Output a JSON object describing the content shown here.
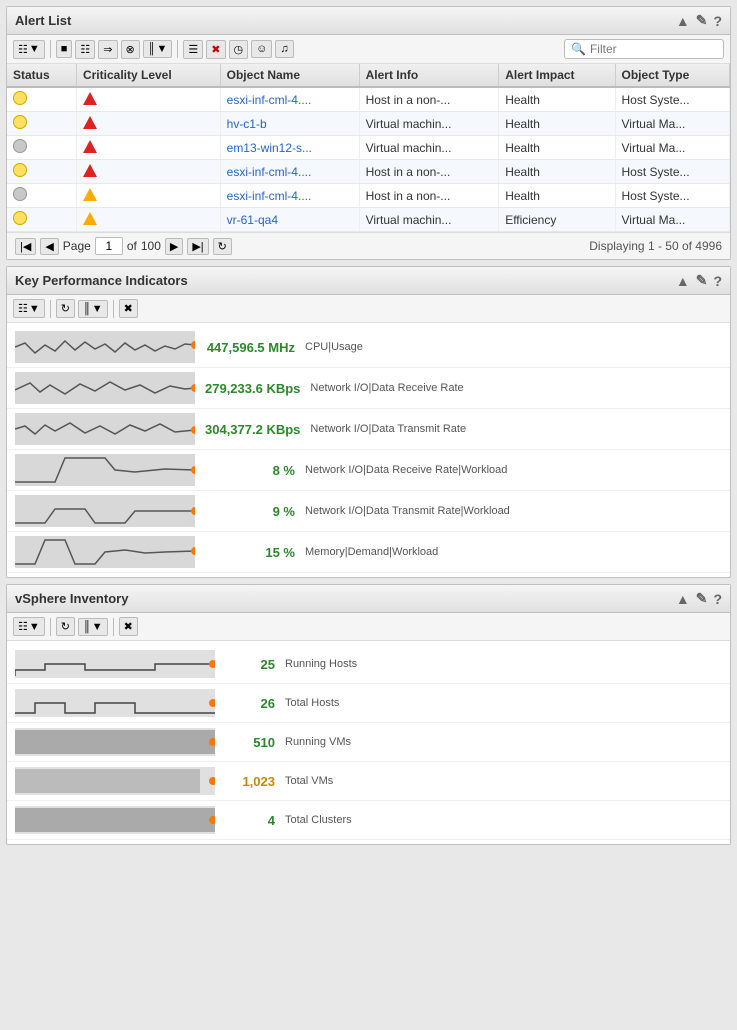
{
  "alertList": {
    "title": "Alert List",
    "filterPlaceholder": "Filter",
    "columns": [
      "Status",
      "Criticality Level",
      "Object Name",
      "Alert Info",
      "Alert Impact",
      "Object Type"
    ],
    "rows": [
      {
        "status": "active",
        "criticality": "red",
        "objectName": "esxi-inf-cml-4....",
        "alertInfo": "Host in a non-...",
        "alertImpact": "Health",
        "objectType": "Host Syste..."
      },
      {
        "status": "active",
        "criticality": "red",
        "objectName": "hv-c1-b",
        "alertInfo": "Virtual machin...",
        "alertImpact": "Health",
        "objectType": "Virtual Ma..."
      },
      {
        "status": "inactive",
        "criticality": "red",
        "objectName": "em13-win12-s...",
        "alertInfo": "Virtual machin...",
        "alertImpact": "Health",
        "objectType": "Virtual Ma..."
      },
      {
        "status": "active",
        "criticality": "red",
        "objectName": "esxi-inf-cml-4....",
        "alertInfo": "Host in a non-...",
        "alertImpact": "Health",
        "objectType": "Host Syste..."
      },
      {
        "status": "inactive",
        "criticality": "warn",
        "objectName": "esxi-inf-cml-4....",
        "alertInfo": "Host in a non-...",
        "alertImpact": "Health",
        "objectType": "Host Syste..."
      },
      {
        "status": "active",
        "criticality": "warn",
        "objectName": "vr-61-qa4",
        "alertInfo": "Virtual machin...",
        "alertImpact": "Efficiency",
        "objectType": "Virtual Ma..."
      }
    ],
    "pagination": {
      "current": "1",
      "total": "100",
      "displayInfo": "Displaying 1 - 50 of 4996"
    }
  },
  "kpi": {
    "title": "Key Performance Indicators",
    "rows": [
      {
        "value": "447,596.5 MHz",
        "label": "CPU|Usage",
        "color": "green"
      },
      {
        "value": "279,233.6 KBps",
        "label": "Network I/O|Data Receive Rate",
        "color": "green"
      },
      {
        "value": "304,377.2 KBps",
        "label": "Network I/O|Data Transmit Rate",
        "color": "green"
      },
      {
        "value": "8 %",
        "label": "Network I/O|Data Receive Rate|Workload",
        "color": "green"
      },
      {
        "value": "9 %",
        "label": "Network I/O|Data Transmit Rate|Workload",
        "color": "green"
      },
      {
        "value": "15 %",
        "label": "Memory|Demand|Workload",
        "color": "green"
      }
    ]
  },
  "inventory": {
    "title": "vSphere Inventory",
    "rows": [
      {
        "value": "25",
        "label": "Running Hosts",
        "color": "green"
      },
      {
        "value": "26",
        "label": "Total Hosts",
        "color": "green"
      },
      {
        "value": "510",
        "label": "Running VMs",
        "color": "green"
      },
      {
        "value": "1,023",
        "label": "Total VMs",
        "color": "orange"
      },
      {
        "value": "4",
        "label": "Total Clusters",
        "color": "green"
      }
    ]
  },
  "icons": {
    "pin": "📌",
    "refresh": "↻",
    "settings": "⚙",
    "up": "▲",
    "help": "?",
    "edit": "✏",
    "filter": "⊘",
    "export": "⇒",
    "calendar": "📅",
    "list": "☰",
    "close": "✕",
    "bell": "🔔",
    "person": "👤",
    "persons": "👥",
    "search": "🔍",
    "prev": "◀",
    "first": "|◀",
    "next": "▶",
    "last": "▶|"
  }
}
